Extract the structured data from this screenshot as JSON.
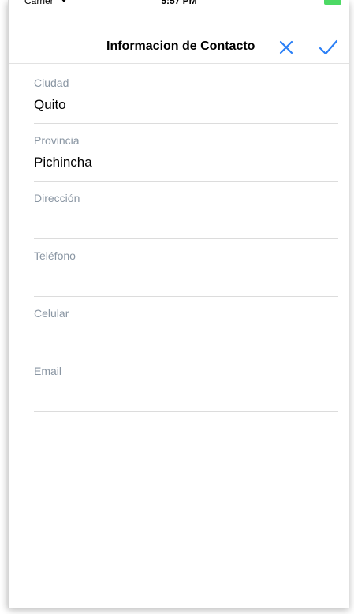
{
  "status_bar": {
    "carrier": "Carrier",
    "time": "5:57 PM"
  },
  "nav": {
    "title": "Informacion de Contacto",
    "cancel_icon": "close-icon",
    "done_icon": "checkmark-icon",
    "accent_color": "#2a7ff6"
  },
  "form": {
    "fields": [
      {
        "label": "Ciudad",
        "value": "Quito"
      },
      {
        "label": "Provincia",
        "value": "Pichincha"
      },
      {
        "label": "Dirección",
        "value": ""
      },
      {
        "label": "Teléfono",
        "value": ""
      },
      {
        "label": "Celular",
        "value": ""
      },
      {
        "label": "Email",
        "value": ""
      }
    ]
  }
}
